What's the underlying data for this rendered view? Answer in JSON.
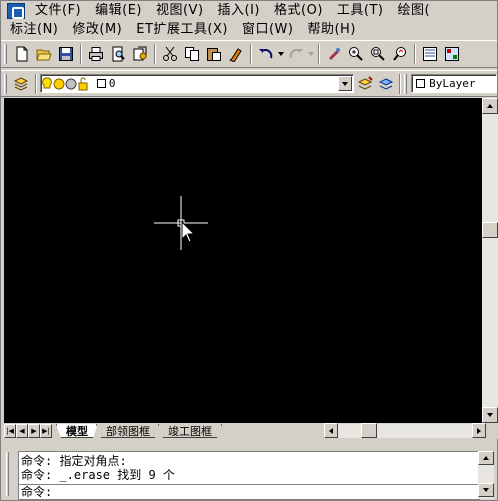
{
  "menu": {
    "row1": [
      "文件(F)",
      "编辑(E)",
      "视图(V)",
      "插入(I)",
      "格式(O)",
      "工具(T)",
      "绘图("
    ],
    "row2": [
      "标注(N)",
      "修改(M)",
      "ET扩展工具(X)",
      "窗口(W)",
      "帮助(H)"
    ]
  },
  "toolbar": {
    "icons": [
      "new-icon",
      "open-icon",
      "save-icon",
      "print-icon",
      "preview-icon",
      "publish-icon",
      "cut-icon",
      "copy-icon",
      "paste-icon",
      "match-properties-icon",
      "undo-icon",
      "redo-icon",
      "pan-icon",
      "zoom-realtime-icon",
      "zoom-window-icon",
      "zoom-previous-icon",
      "properties-icon",
      "design-center-icon"
    ]
  },
  "layer": {
    "current": "0",
    "linetype": "ByLayer"
  },
  "tabs": [
    "模型",
    "部领图框",
    "竣工图框"
  ],
  "command": {
    "line1": "命令: 指定对角点:",
    "line2": "命令: _.erase 找到 9 个",
    "prompt": "命令:"
  }
}
